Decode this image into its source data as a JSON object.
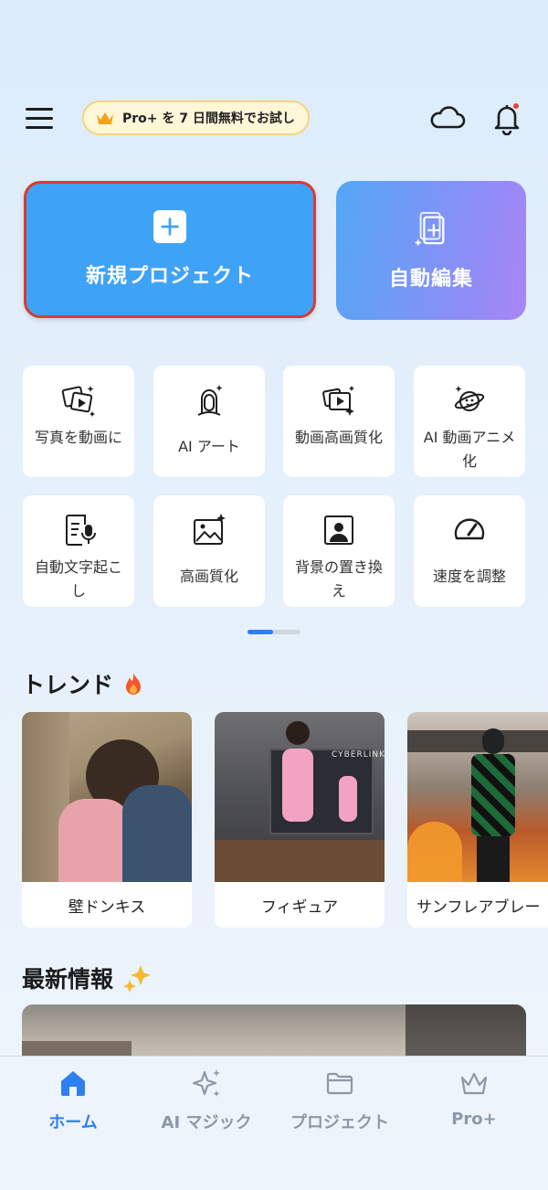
{
  "header": {
    "promo_label": "Pro+ を 7 日間無料でお試し",
    "icons": [
      "menu-icon",
      "crown-icon",
      "cloud-icon",
      "bell-icon"
    ]
  },
  "cards": {
    "new_project": "新規プロジェクト",
    "auto_edit": "自動編集"
  },
  "tools": [
    {
      "label": "写真を動画に",
      "icon": "photo-to-video-icon"
    },
    {
      "label": "AI アート",
      "icon": "ai-art-icon"
    },
    {
      "label": "動画高画質化",
      "icon": "video-enhance-icon"
    },
    {
      "label": "AI 動画アニメ化",
      "icon": "video-anime-icon"
    },
    {
      "label": "自動文字起こし",
      "icon": "transcribe-icon"
    },
    {
      "label": "高画質化",
      "icon": "image-enhance-icon"
    },
    {
      "label": "背景の置き換え",
      "icon": "background-replace-icon"
    },
    {
      "label": "速度を調整",
      "icon": "speed-icon"
    }
  ],
  "pager": {
    "page": 1,
    "total": 2
  },
  "trend": {
    "title": "トレンド",
    "items": [
      {
        "title": "壁ドンキス"
      },
      {
        "title": "フィギュア",
        "image_text": "CYBERLINK"
      },
      {
        "title": "サンフレアブレー"
      }
    ]
  },
  "news": {
    "title": "最新情報"
  },
  "bottom_nav": [
    {
      "label": "ホーム",
      "icon": "home-icon",
      "active": true
    },
    {
      "label": "AI マジック",
      "icon": "sparkle-icon",
      "active": false
    },
    {
      "label": "プロジェクト",
      "icon": "folder-icon",
      "active": false
    },
    {
      "label": "Pro+",
      "icon": "crown-icon",
      "active": false
    }
  ],
  "colors": {
    "accent": "#2f7ff0",
    "card_blue": "#3ea3f7",
    "highlight_border": "#d93b32",
    "notification_dot": "#e8403a"
  }
}
